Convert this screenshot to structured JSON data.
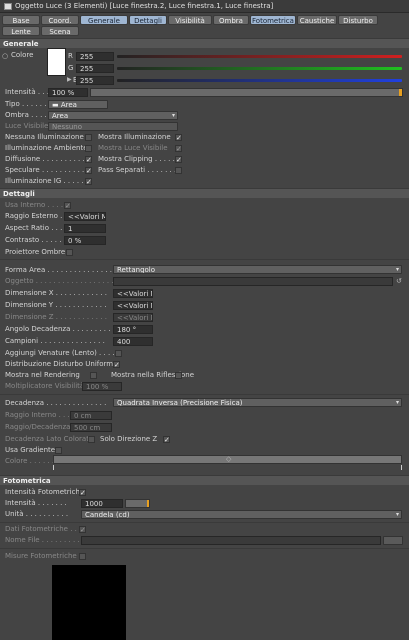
{
  "window": {
    "title": "Oggetto Luce (3 Elementi) [Luce finestra.2, Luce finestra.1, Luce finestra]"
  },
  "tabs": [
    "Base",
    "Coord.",
    "Generale",
    "Dettagli",
    "Visibilità",
    "Ombra",
    "Fotometrica",
    "Caustiche",
    "Disturbo",
    "Lente",
    "Scena"
  ],
  "active_tabs": [
    "Generale",
    "Dettagli",
    "Fotometrica"
  ],
  "generale": {
    "section": "Generale",
    "color_label": "Colore",
    "r_label": "R",
    "r_value": "255",
    "g_label": "G",
    "g_value": "255",
    "b_label": "B",
    "b_value": "255",
    "intensity_label": "Intensità . . . . .",
    "intensity_value": "100 %",
    "type_label": "Tipo . . . . . . . .",
    "type_value": "Area",
    "shadow_label": "Ombra . . . . . . .",
    "shadow_value": "Area",
    "visible_label": "Luce Visibile . . .",
    "visible_value": "Nessuno",
    "checks": [
      {
        "label": "Nessuna Illuminazione",
        "checked": false,
        "dim": false
      },
      {
        "label": "Mostra Illuminazione",
        "checked": true,
        "dim": false
      },
      {
        "label": "Illuminazione Ambiente",
        "checked": false,
        "dim": false
      },
      {
        "label": "Mostra Luce Visibile",
        "checked": true,
        "dim": true
      },
      {
        "label": "Diffusione . . . . . . . . . .",
        "checked": true,
        "dim": false
      },
      {
        "label": "Mostra Clipping . . . . .",
        "checked": true,
        "dim": false
      },
      {
        "label": "Speculare . . . . . . . . . .",
        "checked": true,
        "dim": false
      },
      {
        "label": "Pass Separati . . . . . . .",
        "checked": false,
        "dim": false
      },
      {
        "label": "Illuminazione IG . . . . . .",
        "checked": true,
        "dim": false
      }
    ]
  },
  "dettagli": {
    "section": "Dettagli",
    "usa_interno": "Usa Interno . . . . .",
    "raggio_esterno": "Raggio Esterno . .",
    "raggio_esterno_value": "<<Valori M",
    "aspect_ratio": "Aspect Ratio . . . .",
    "aspect_ratio_value": "1",
    "contrasto": "Contrasto . . . . . .",
    "contrasto_value": "0 %",
    "proiettore": "Proiettore Ombre",
    "forma_area": "Forma Area . . . . . . . . . . . . . . .",
    "forma_area_value": "Rettangolo",
    "oggetto": "Oggetto . . . . . . . . . . . . . . . . . .",
    "dim_x": "Dimensione X . . . . . . . . . . . .",
    "dim_x_value": "<<Valori M",
    "dim_y": "Dimensione Y . . . . . . . . . . . .",
    "dim_y_value": "<<Valori M",
    "dim_z": "Dimensione Z . . . . . . . . . . . .",
    "dim_z_value": "<<Valori M",
    "angolo": "Angolo Decadenza . . . . . . . . .",
    "angolo_value": "180 °",
    "campioni": "Campioni . . . . . . . . . . . . . . .",
    "campioni_value": "400",
    "venature": "Aggiungi Venature (Lento) . . . . .",
    "distribuzione": "Distribuzione Disturbo Uniforme",
    "mostra_rendering": "Mostra nel Rendering",
    "mostra_riflessione": "Mostra nella Riflessione",
    "moltiplicatore": "Moltiplicatore Visibilità",
    "moltiplicatore_value": "100 %",
    "decadenza": "Decadenza . . . . . . . . . . . . . .",
    "decadenza_value": "Quadrata Inversa (Precisione Fisica)",
    "raggio_interno": "Raggio Interno . . .",
    "raggio_interno_value": "0 cm",
    "raggio_decadenza": "Raggio/Decadenza .",
    "raggio_decadenza_value": "500 cm",
    "decadenza_lato": "Decadenza Lato Colorata",
    "solo_direzione": "Solo Direzione Z",
    "usa_gradiente": "Usa Gradiente",
    "colore": "Colore . . . . . . ."
  },
  "fotometrica": {
    "section": "Fotometrica",
    "intensita_fot": "Intensità Fotometriche",
    "intensita": "Intensità . . . . . . .",
    "intensita_value": "1000",
    "unita": "Unità . . . . . . . . . .",
    "unita_value": "Candela (cd)",
    "dati": "Dati Fotometriche . . . .",
    "nome_file": "Nome File . . . . . . . . .",
    "misure": "Misure Fotometriche"
  },
  "colors": {
    "accent": "#9fb6d2",
    "panel": "#444444",
    "red": "#d02020",
    "green": "#20c020",
    "blue": "#2040e0"
  }
}
